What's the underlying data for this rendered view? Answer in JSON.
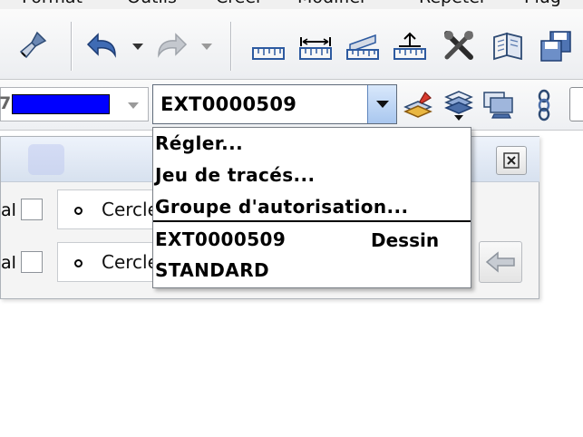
{
  "menubar": {
    "items": [
      "Format",
      "Outils",
      "Créer",
      "Modifier",
      "Répéter",
      "Plug"
    ]
  },
  "toolbar1": {
    "icons": [
      "paint-brush-icon",
      "undo-icon",
      "redo-icon",
      "ruler-icon",
      "dimension-horizontal-icon",
      "dimension-angled-icon",
      "dimension-vertical-icon",
      "tools-icon",
      "open-book-icon",
      "floppy-disk-icon"
    ]
  },
  "toolbar2": {
    "color_number": "7",
    "color_value": "#0000ff",
    "layer_value": "EXT0000509",
    "icons": [
      "layer-paint-icon",
      "layer-stack-icon",
      "display-icon",
      "chain-icon"
    ]
  },
  "panel": {
    "rows": [
      {
        "label": "al",
        "field": "Cercle"
      },
      {
        "label": "al",
        "field": "Cercle"
      }
    ]
  },
  "dropdown": {
    "items": [
      "Régler...",
      "Jeu de tracés...",
      "Groupe d'autorisation..."
    ],
    "layers": [
      {
        "name": "EXT0000509",
        "type": "Dessin"
      },
      {
        "name": "STANDARD",
        "type": ""
      }
    ]
  },
  "colors": {
    "accent": "#0000ff",
    "combo_button": "#a9c7ef"
  }
}
